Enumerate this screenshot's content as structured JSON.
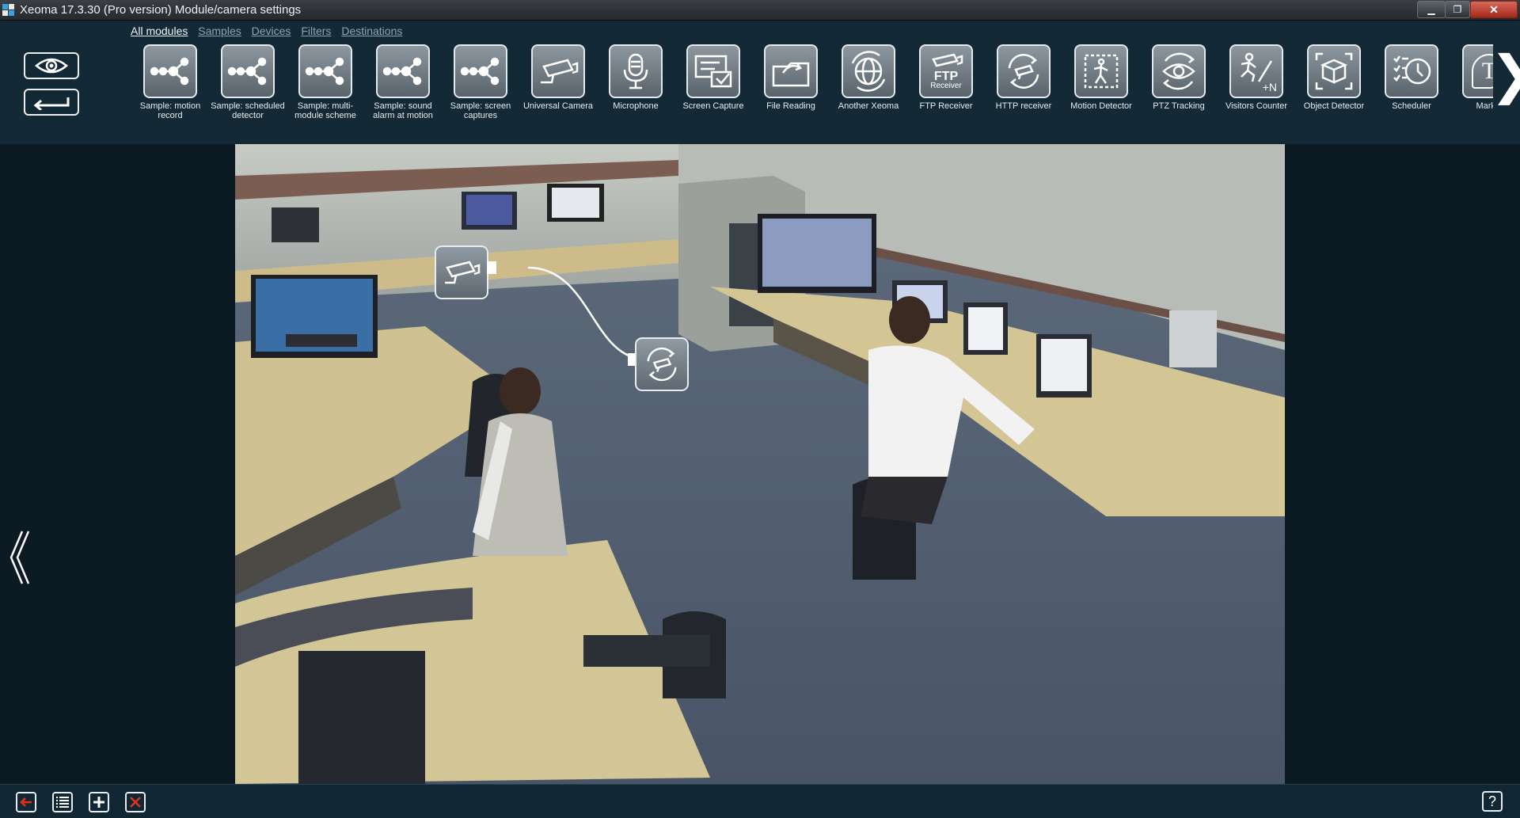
{
  "window": {
    "title": "Xeoma 17.3.30 (Pro version) Module/camera settings",
    "minimize_glyph": "▁",
    "maximize_glyph": "❐",
    "close_glyph": "✕"
  },
  "tabs": [
    {
      "label": "All modules",
      "active": true
    },
    {
      "label": "Samples"
    },
    {
      "label": "Devices"
    },
    {
      "label": "Filters"
    },
    {
      "label": "Destinations"
    }
  ],
  "side_buttons": [
    {
      "icon": "eye-icon"
    },
    {
      "icon": "return-arrow-icon"
    }
  ],
  "modules": [
    {
      "label": "Sample: motion record",
      "icon": "chain-icon"
    },
    {
      "label": "Sample: scheduled detector",
      "icon": "chain-icon"
    },
    {
      "label": "Sample: multi-module scheme",
      "icon": "chain-icon"
    },
    {
      "label": "Sample: sound alarm at motion",
      "icon": "chain-icon"
    },
    {
      "label": "Sample: screen captures",
      "icon": "chain-icon"
    },
    {
      "label": "Universal Camera",
      "icon": "camera-icon"
    },
    {
      "label": "Microphone",
      "icon": "microphone-icon"
    },
    {
      "label": "Screen Capture",
      "icon": "screen-capture-icon"
    },
    {
      "label": "File Reading",
      "icon": "folder-icon"
    },
    {
      "label": "Another Xeoma",
      "icon": "globe-icon"
    },
    {
      "label": "FTP Receiver",
      "icon": "ftp-icon",
      "icon_text": "FTP",
      "icon_subtext": "Receiver"
    },
    {
      "label": "HTTP receiver",
      "icon": "http-camera-icon"
    },
    {
      "label": "Motion Detector",
      "icon": "motion-icon"
    },
    {
      "label": "PTZ Tracking",
      "icon": "eye-icon"
    },
    {
      "label": "Visitors Counter",
      "icon": "visitors-icon",
      "icon_text": "+N"
    },
    {
      "label": "Object Detector",
      "icon": "box-icon"
    },
    {
      "label": "Scheduler",
      "icon": "scheduler-icon"
    },
    {
      "label": "Markin",
      "icon": "text-icon",
      "icon_text": "T"
    }
  ],
  "scheme_nodes": [
    {
      "name": "universal-camera-node",
      "icon": "camera-icon"
    },
    {
      "name": "http-receiver-node",
      "icon": "http-camera-icon"
    }
  ],
  "scroll": {
    "left_glyph": "《",
    "right_glyph": "❯"
  },
  "bottom_buttons": [
    {
      "icon": "back-icon",
      "color": "#e0301e"
    },
    {
      "icon": "list-icon"
    },
    {
      "icon": "add-icon"
    },
    {
      "icon": "delete-icon",
      "color": "#e0301e"
    }
  ],
  "help_label": "?"
}
